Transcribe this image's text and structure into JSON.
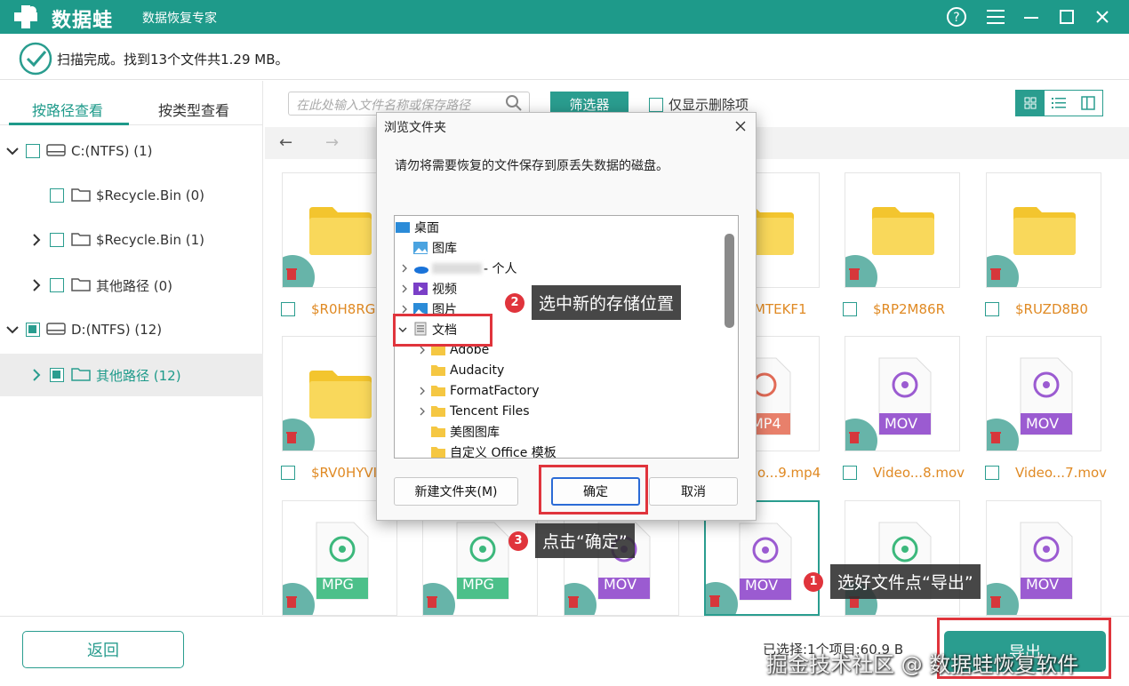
{
  "app": {
    "name": "数据蛙",
    "subtitle": "数据恢复专家",
    "accent": "#1e9a8a"
  },
  "status": {
    "message": "扫描完成。找到13个文件共1.29 MB。"
  },
  "sidebar": {
    "tabs": [
      "按路径查看",
      "按类型查看"
    ],
    "tree": [
      {
        "label": "C:(NTFS) (1)",
        "icon": "drive-icon"
      },
      {
        "label": "$Recycle.Bin (0)",
        "icon": "folder-icon"
      },
      {
        "label": "$Recycle.Bin (1)",
        "icon": "folder-icon"
      },
      {
        "label": "其他路径 (0)",
        "icon": "folder-icon"
      },
      {
        "label": "D:(NTFS) (12)",
        "icon": "drive-icon"
      },
      {
        "label": "其他路径 (12)",
        "icon": "folder-icon"
      }
    ]
  },
  "toolbar": {
    "search_placeholder": "在此处输入文件名称或保存路径",
    "filter_label": "筛选器",
    "deleted_only_label": "仅显示删除项"
  },
  "grid": {
    "row1_names": [
      "$R0H8RG",
      "",
      "",
      "",
      "MTEKF1",
      "$RP2M86R",
      "$RUZD8B0"
    ],
    "row2_names": [
      "$RV0HYVI",
      "",
      "",
      "",
      "o...9.mp4",
      "Video...8.mov",
      "Video...7.mov"
    ],
    "row2_types": [
      "",
      "",
      "",
      "",
      "MP4",
      "MOV",
      "MOV"
    ],
    "row3_types": [
      "MPG",
      "MPG",
      "MOV",
      "MOV",
      "",
      "MOV",
      "MOV"
    ]
  },
  "bottom": {
    "back_label": "返回",
    "selection_info": "已选择:1个项目:60.9 B",
    "export_label": "导出"
  },
  "dialog": {
    "title": "浏览文件夹",
    "message": "请勿将需要恢复的文件保存到原丢失数据的磁盘。",
    "tree": [
      {
        "label": "桌面"
      },
      {
        "label": "图库"
      },
      {
        "label": "- 个人"
      },
      {
        "label": "视频"
      },
      {
        "label": "图片"
      },
      {
        "label": "文档"
      },
      {
        "label": "Adobe"
      },
      {
        "label": "Audacity"
      },
      {
        "label": "FormatFactory"
      },
      {
        "label": "Tencent Files"
      },
      {
        "label": "美图图库"
      },
      {
        "label": "自定义 Office 模板"
      }
    ],
    "new_folder_label": "新建文件夹(M)",
    "ok_label": "确定",
    "cancel_label": "取消"
  },
  "callouts": [
    {
      "num": "1",
      "text": "选好文件点“导出”"
    },
    {
      "num": "2",
      "text": "选中新的存储位置"
    },
    {
      "num": "3",
      "text": "点击“确定”"
    }
  ],
  "watermark": "掘金技术社区 @ 数据蛙恢复软件"
}
